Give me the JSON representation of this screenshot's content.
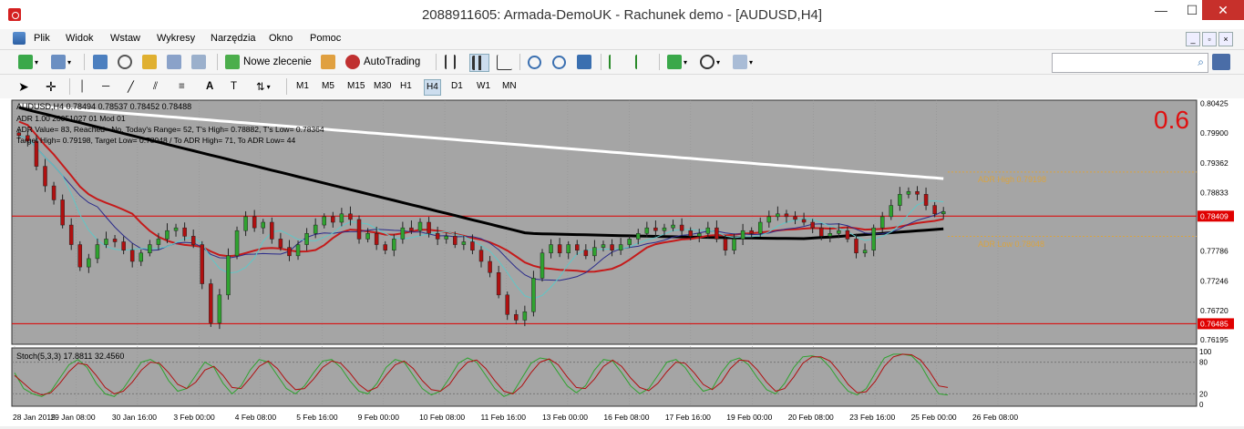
{
  "window": {
    "title": "2088911605: Armada-DemoUK - Rachunek demo - [AUDUSD,H4]",
    "minimize": "—",
    "maximize": "☐",
    "close": "✕"
  },
  "menu": {
    "items": [
      {
        "label": "Plik"
      },
      {
        "label": "Widok"
      },
      {
        "label": "Wstaw"
      },
      {
        "label": "Wykresy"
      },
      {
        "label": "Narzędzia"
      },
      {
        "label": "Okno"
      },
      {
        "label": "Pomoc"
      }
    ],
    "mdi": {
      "minimize": "_",
      "restore": "▫",
      "close": "×"
    }
  },
  "toolbar": {
    "new_order": "Nowe zlecenie",
    "auto_trading": "AutoTrading",
    "search_placeholder": ""
  },
  "timeframes": [
    "M1",
    "M5",
    "M15",
    "M30",
    "H1",
    "H4",
    "D1",
    "W1",
    "MN"
  ],
  "active_timeframe": "H4",
  "chart": {
    "header": "AUDUSD,H4  0.78494 0.78537 0.78452 0.78488",
    "info_lines": [
      "ADR 1.00 20051027 01 Mod 01",
      "ADR Value= 83, Reached= No, Today's Range= 52, T's High= 0.78882, T's Low= 0.78364",
      "Target High= 0.79198, Target Low= 0.78048 / To ADR High= 71, To ADR Low= 44"
    ],
    "big_label": "0.6",
    "adr_high_label": "ADR High  0.79198",
    "adr_low_label": "ADR Low  0.78048",
    "price_axis": [
      "0.80425",
      "0.79900",
      "0.79362",
      "0.78833",
      "0.78409",
      "0.77786",
      "0.77246",
      "0.76720",
      "0.76485",
      "0.76195"
    ],
    "current_price": "0.78409",
    "support_price": "0.76485",
    "time_axis": [
      "28 Jan 2015",
      "29 Jan 08:00",
      "30 Jan 16:00",
      "3 Feb 00:00",
      "4 Feb 08:00",
      "5 Feb 16:00",
      "9 Feb 00:00",
      "10 Feb 08:00",
      "11 Feb 16:00",
      "13 Feb 00:00",
      "16 Feb 08:00",
      "17 Feb 16:00",
      "19 Feb 00:00",
      "20 Feb 08:00",
      "23 Feb 16:00",
      "25 Feb 00:00",
      "26 Feb 08:00"
    ],
    "stoch_label": "Stoch(5,3,3) 17.8811 32.4560",
    "stoch_axis": [
      "100",
      "80",
      "20",
      "0"
    ],
    "colors": {
      "background": "#a5a5a5",
      "bull": "#2fa32f",
      "bear": "#b01010",
      "ma_white": "#ffffff",
      "ma_black": "#000000",
      "ma_red": "#c51a1a",
      "ma_blue": "#2a2a8a",
      "ma_cyan": "#5fc7c7",
      "hline": "#e00000",
      "adr_line": "#d9a441"
    }
  },
  "chart_data": {
    "type": "candlestick",
    "symbol": "AUDUSD",
    "timeframe": "H4",
    "ohlc_last": {
      "open": 0.78494,
      "high": 0.78537,
      "low": 0.78452,
      "close": 0.78488
    },
    "ylim": [
      0.7615,
      0.8045
    ],
    "close_series": [
      0.7985,
      0.7975,
      0.793,
      0.7895,
      0.787,
      0.7825,
      0.779,
      0.775,
      0.7765,
      0.779,
      0.78,
      0.7795,
      0.778,
      0.776,
      0.7775,
      0.779,
      0.78,
      0.7815,
      0.782,
      0.7805,
      0.779,
      0.772,
      0.765,
      0.77,
      0.777,
      0.7815,
      0.784,
      0.782,
      0.783,
      0.78,
      0.7785,
      0.777,
      0.779,
      0.781,
      0.7825,
      0.784,
      0.783,
      0.7845,
      0.7835,
      0.78,
      0.781,
      0.779,
      0.778,
      0.78,
      0.782,
      0.7815,
      0.783,
      0.781,
      0.78,
      0.7805,
      0.779,
      0.7795,
      0.778,
      0.776,
      0.774,
      0.77,
      0.7665,
      0.7655,
      0.767,
      0.773,
      0.7775,
      0.779,
      0.7775,
      0.779,
      0.778,
      0.777,
      0.7785,
      0.779,
      0.778,
      0.779,
      0.78,
      0.781,
      0.782,
      0.7815,
      0.782,
      0.7825,
      0.7815,
      0.7805,
      0.781,
      0.782,
      0.78,
      0.778,
      0.78,
      0.7815,
      0.781,
      0.783,
      0.784,
      0.7845,
      0.784,
      0.7835,
      0.783,
      0.782,
      0.7805,
      0.781,
      0.7815,
      0.78,
      0.7775,
      0.778,
      0.782,
      0.784,
      0.786,
      0.788,
      0.7885,
      0.788,
      0.786,
      0.7845,
      0.7849
    ],
    "stoch_k": [
      60,
      30,
      20,
      15,
      25,
      50,
      75,
      85,
      70,
      40,
      20,
      15,
      30,
      55,
      80,
      85,
      75,
      45,
      25,
      30,
      55,
      80,
      70,
      40,
      20,
      35,
      65,
      85,
      80,
      55,
      30,
      20,
      35,
      60,
      82,
      85,
      70,
      45,
      25,
      20,
      40,
      70,
      85,
      80,
      55,
      30,
      18,
      25,
      50,
      78,
      88,
      80,
      55,
      30,
      15,
      22,
      50,
      78,
      88,
      85,
      60,
      35,
      22,
      35,
      65,
      85,
      82,
      60,
      35,
      20,
      30,
      55,
      80,
      85,
      70,
      45,
      25,
      30,
      60,
      82,
      88,
      75,
      50,
      28,
      20,
      40,
      70,
      90,
      92,
      88,
      70,
      45,
      25,
      18,
      30,
      60,
      88,
      95,
      95,
      92,
      75,
      45,
      20,
      18
    ],
    "stoch_d": [
      55,
      40,
      25,
      18,
      22,
      40,
      62,
      78,
      75,
      55,
      32,
      20,
      25,
      42,
      65,
      80,
      78,
      60,
      38,
      30,
      42,
      65,
      72,
      55,
      32,
      30,
      50,
      72,
      82,
      68,
      45,
      28,
      30,
      48,
      70,
      82,
      78,
      60,
      38,
      25,
      32,
      55,
      75,
      82,
      68,
      45,
      28,
      25,
      38,
      62,
      80,
      84,
      68,
      45,
      25,
      20,
      35,
      60,
      80,
      86,
      75,
      52,
      32,
      30,
      48,
      72,
      84,
      72,
      50,
      32,
      26,
      40,
      62,
      80,
      78,
      60,
      38,
      28,
      42,
      68,
      84,
      82,
      65,
      42,
      25,
      30,
      52,
      78,
      90,
      90,
      82,
      62,
      38,
      22,
      24,
      44,
      72,
      90,
      95,
      94,
      84,
      62,
      35,
      32
    ]
  }
}
